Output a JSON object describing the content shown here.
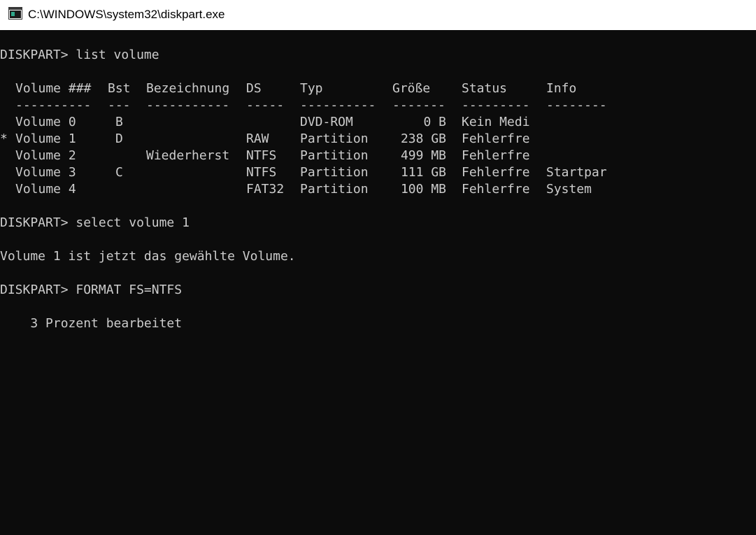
{
  "window": {
    "title": "C:\\WINDOWS\\system32\\diskpart.exe",
    "icon": "console-app-icon"
  },
  "console": {
    "cmd1": "DISKPART> list volume",
    "header": {
      "marker": "",
      "volume": "Volume ###",
      "bst": "Bst",
      "bez": "Bezeichnung",
      "ds": "DS",
      "typ": "Typ",
      "size": "Größe",
      "status": "Status",
      "info": "Info"
    },
    "separator": {
      "volume": "----------",
      "bst": "---",
      "bez": "-----------",
      "ds": "-----",
      "typ": "----------",
      "size": "-------",
      "status": "---------",
      "info": "--------"
    },
    "rows": [
      {
        "marker": "",
        "volume": "Volume 0",
        "bst": "B",
        "bez": "",
        "ds": "",
        "typ": "DVD-ROM",
        "size": "0 B",
        "status": "Kein Medi",
        "info": ""
      },
      {
        "marker": "*",
        "volume": "Volume 1",
        "bst": "D",
        "bez": "",
        "ds": "RAW",
        "typ": "Partition",
        "size": "238 GB",
        "status": "Fehlerfre",
        "info": ""
      },
      {
        "marker": "",
        "volume": "Volume 2",
        "bst": "",
        "bez": "Wiederherst",
        "ds": "NTFS",
        "typ": "Partition",
        "size": "499 MB",
        "status": "Fehlerfre",
        "info": ""
      },
      {
        "marker": "",
        "volume": "Volume 3",
        "bst": "C",
        "bez": "",
        "ds": "NTFS",
        "typ": "Partition",
        "size": "111 GB",
        "status": "Fehlerfre",
        "info": "Startpar"
      },
      {
        "marker": "",
        "volume": "Volume 4",
        "bst": "",
        "bez": "",
        "ds": "FAT32",
        "typ": "Partition",
        "size": "100 MB",
        "status": "Fehlerfre",
        "info": "System"
      }
    ],
    "cmd2": "DISKPART> select volume 1",
    "msg1": "Volume 1 ist jetzt das gewählte Volume.",
    "cmd3": "DISKPART> FORMAT FS=NTFS",
    "progress": "    3 Prozent bearbeitet",
    "colors": {
      "background": "#0c0c0c",
      "text": "#cccccc",
      "titlebar": "#ffffff"
    }
  }
}
